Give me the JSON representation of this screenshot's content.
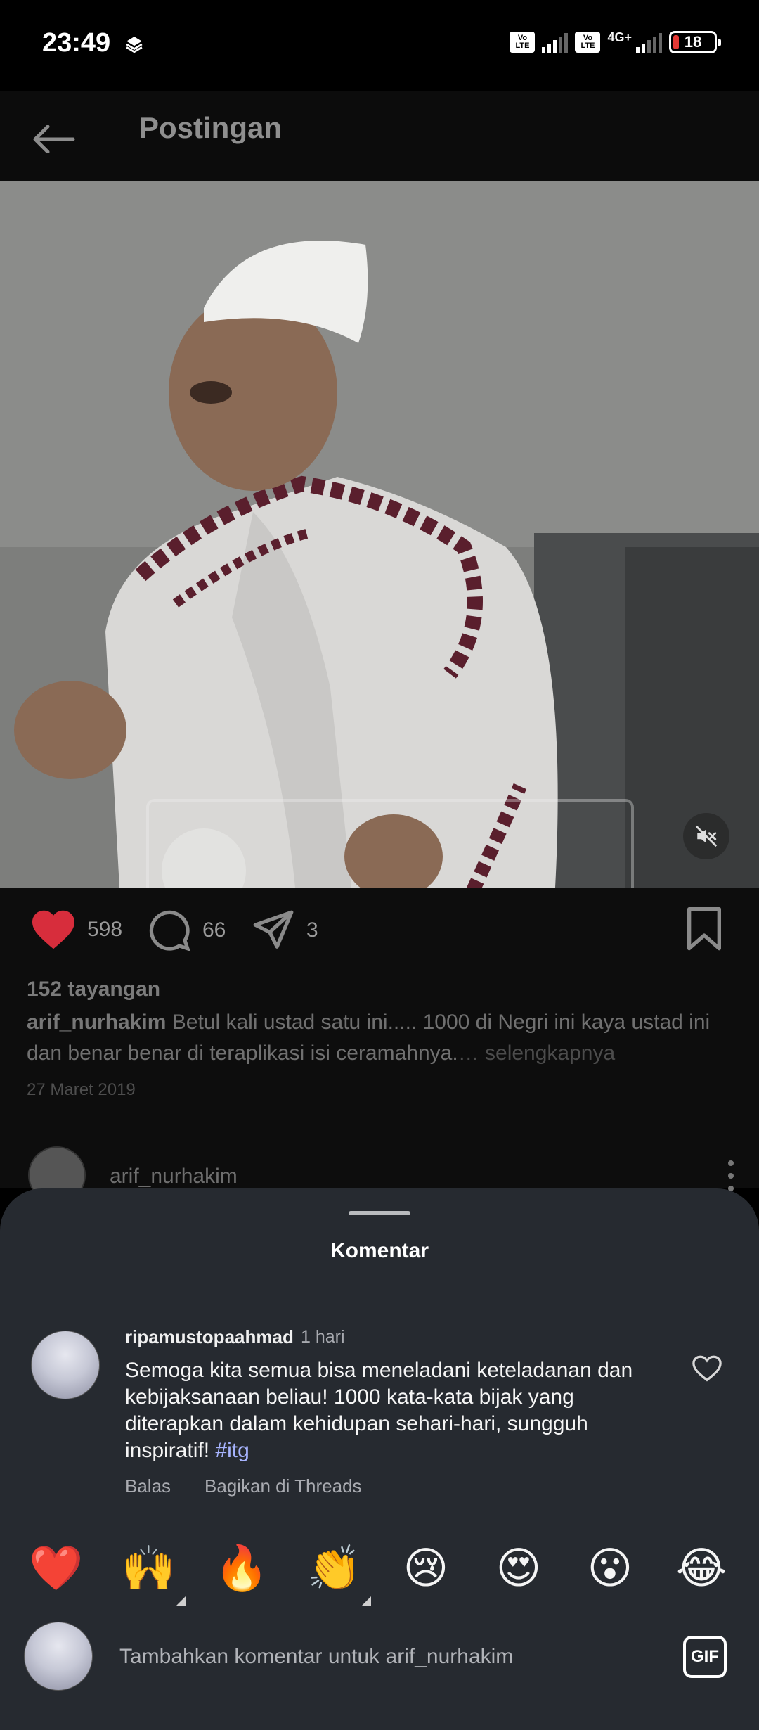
{
  "status_bar": {
    "time": "23:49",
    "volte1": "Vo LTE",
    "volte2": "Vo LTE",
    "network": "4G+",
    "battery_level": "18",
    "battery_color": "#e53935"
  },
  "header": {
    "title": "Postingan",
    "back_icon": "arrow-left-icon"
  },
  "video": {
    "mute_icon": "muted-speaker-icon"
  },
  "actions": {
    "likes": "598",
    "comments": "66",
    "shares": "3",
    "like_color": "#e0303f"
  },
  "post": {
    "views": "152 tayangan",
    "username": "arif_nurhakim",
    "caption": "Betul kali ustad satu ini..... 1000 di Negri ini kaya ustad ini dan benar benar di teraplikasi isi ceramahnya.",
    "more": "… selengkapnya",
    "date": "27 Maret 2019",
    "author": "arif_nurhakim"
  },
  "comments_sheet": {
    "title": "Komentar",
    "comment": {
      "username": "ripamustopaahmad",
      "time": "1 hari",
      "text": "Semoga kita semua bisa meneladani keteladanan dan kebijaksanaan beliau! 1000 kata-kata bijak yang diterapkan dalam kehidupan sehari-hari, sungguh inspiratif!",
      "hashtag": "#itg",
      "reply": "Balas",
      "share": "Bagikan di Threads"
    },
    "emojis": [
      "❤️",
      "🙌",
      "🔥",
      "👏",
      "😢",
      "😍",
      "😮",
      "😂"
    ],
    "input_placeholder": "Tambahkan komentar untuk arif_nurhakim",
    "gif_label": "GIF"
  }
}
